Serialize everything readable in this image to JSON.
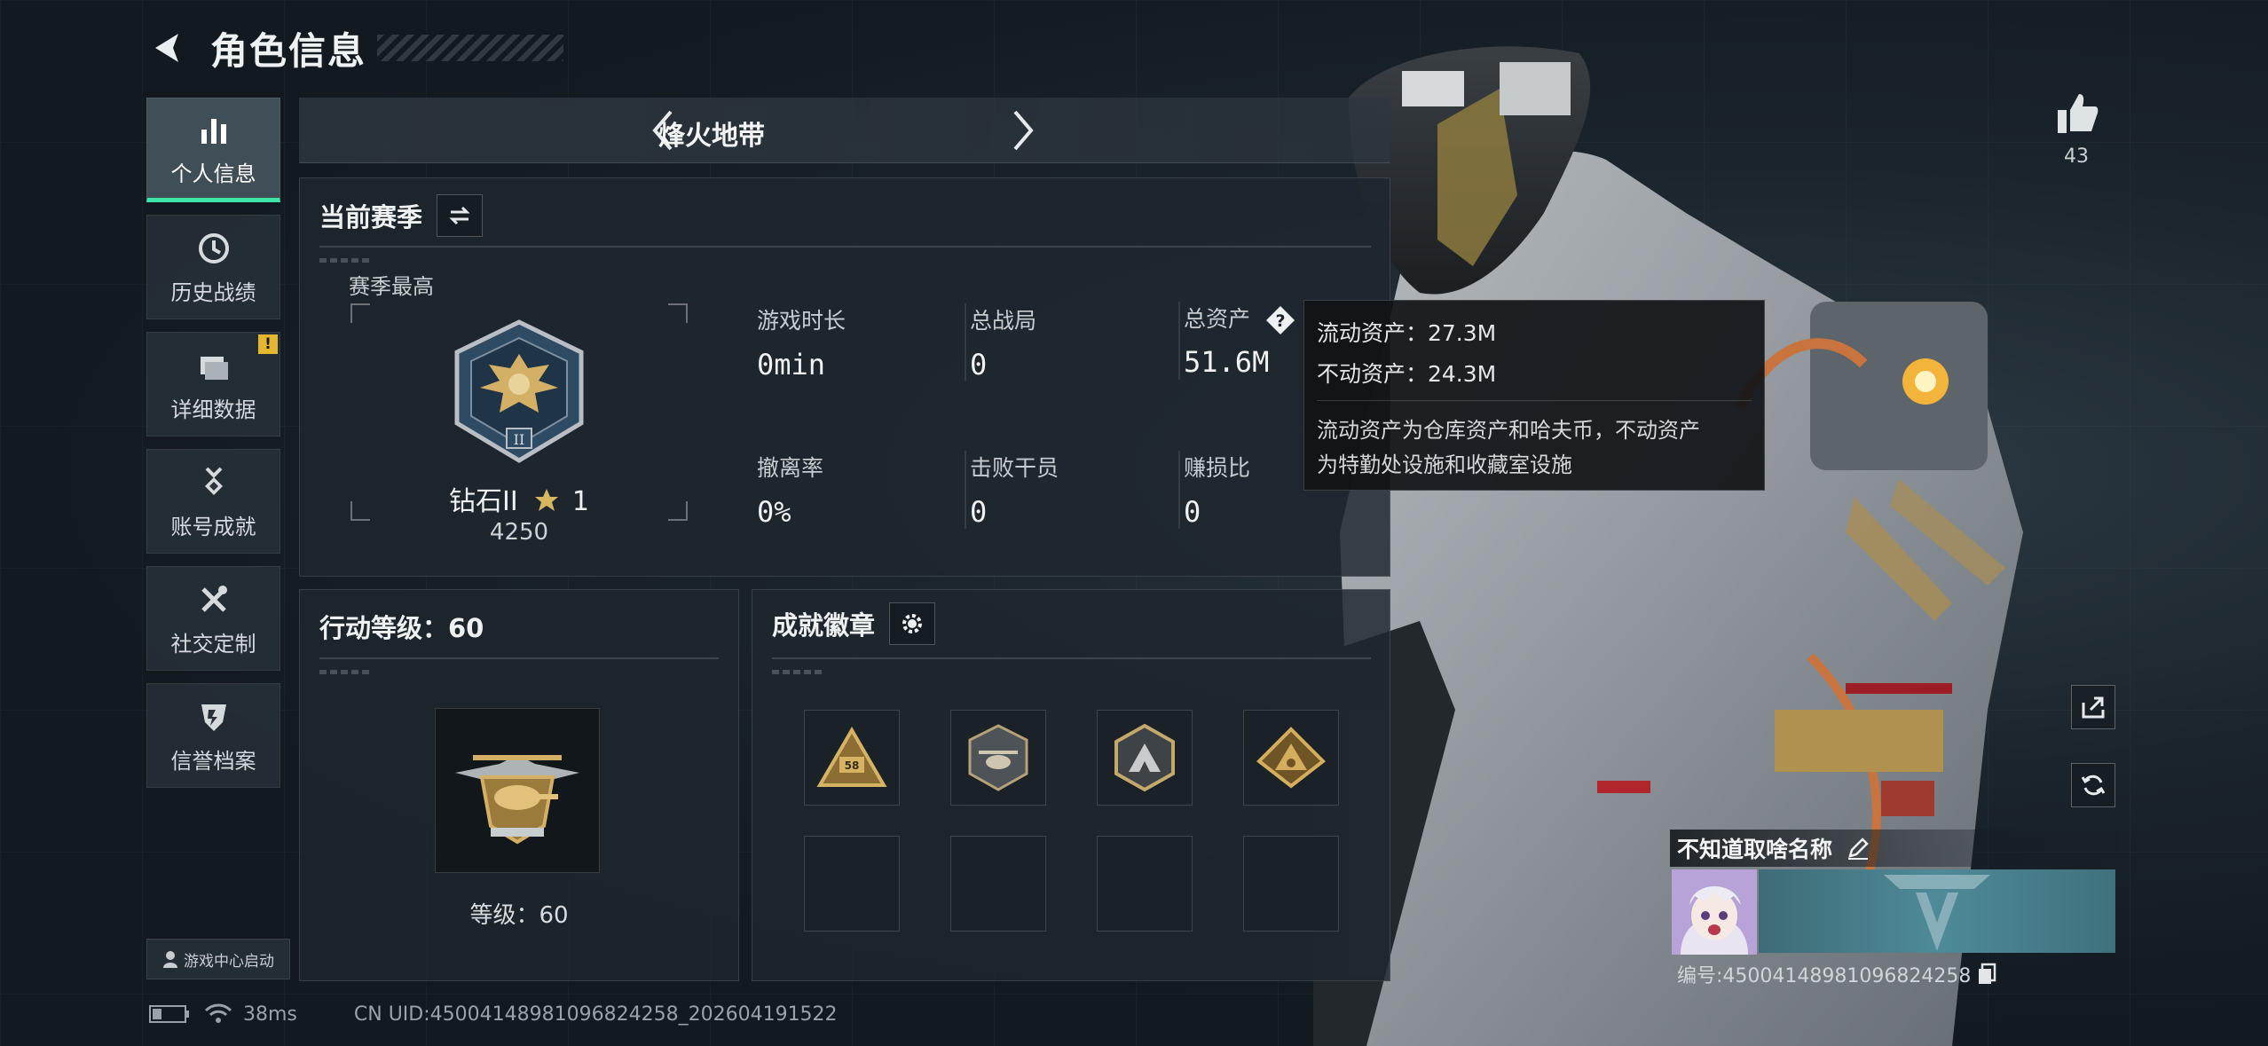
{
  "header": {
    "title": "角色信息"
  },
  "sidebar": {
    "items": [
      {
        "label": "个人信息",
        "icon": "bar-chart-icon",
        "active": true
      },
      {
        "label": "历史战绩",
        "icon": "clock-icon"
      },
      {
        "label": "详细数据",
        "icon": "folder-icon",
        "badge": "!"
      },
      {
        "label": "账号成就",
        "icon": "medal-icon"
      },
      {
        "label": "社交定制",
        "icon": "tools-icon"
      },
      {
        "label": "信誉档案",
        "icon": "shield-icon"
      }
    ],
    "launch_chip": "游戏中心启动"
  },
  "mode": {
    "title": "烽火地带"
  },
  "season": {
    "title": "当前赛季",
    "sub": "赛季最高",
    "rank_name": "钻石II",
    "rank_stars": "1",
    "rank_score": "4250",
    "stats": [
      {
        "label": "游戏时长",
        "value": "0min"
      },
      {
        "label": "总战局",
        "value": "0"
      },
      {
        "label": "总资产",
        "value": "51.6M"
      },
      {
        "label": "撤离率",
        "value": "0%"
      },
      {
        "label": "击败干员",
        "value": "0"
      },
      {
        "label": "赚损比",
        "value": "0"
      }
    ]
  },
  "tooltip": {
    "liquid": "流动资产：27.3M",
    "fixed": "不动资产：24.3M",
    "desc_1": "流动资产为仓库资产和哈夫币，不动资产",
    "desc_2": "为特勤处设施和收藏室设施"
  },
  "action_level": {
    "title": "行动等级：60",
    "level_text": "等级：60"
  },
  "achievements": {
    "title": "成就徽章",
    "badges": [
      "badge-58-icon",
      "helicopter-badge-icon",
      "mountain-badge-icon",
      "triangle-badge-icon"
    ],
    "empty_slots": 4
  },
  "status": {
    "ping": "38ms",
    "uid": "CN UID:45004148981096824258_202604191522"
  },
  "profile": {
    "likes": "43",
    "name": "不知道取啥名称",
    "card_id": "编号:45004148981096824258"
  },
  "colors": {
    "accent": "#3ce6a6",
    "badge_warning": "#e5b730",
    "panel_bg": "#1e272e",
    "gold": "#c9a24a"
  }
}
